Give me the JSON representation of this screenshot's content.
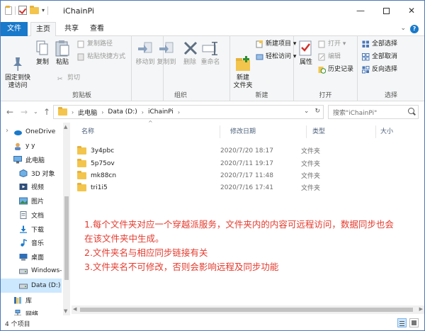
{
  "window": {
    "title": "iChainPi",
    "minimize_icon": "minimize-icon",
    "maximize_icon": "maximize-icon",
    "close_icon": "close-icon"
  },
  "tabs": {
    "file": "文件",
    "home": "主页",
    "share": "共享",
    "view": "查看"
  },
  "ribbon": {
    "clipboard": {
      "label": "剪贴板",
      "pin": "固定到快\n速访问",
      "copy": "复制",
      "paste": "粘贴",
      "cut": "剪切",
      "copy_path": "复制路径",
      "paste_shortcut": "粘贴快捷方式"
    },
    "organize": {
      "label": "组织",
      "move_to": "移动到",
      "copy_to": "复制到",
      "delete": "删除",
      "rename": "重命名"
    },
    "new": {
      "label": "新建",
      "new_folder": "新建\n文件夹",
      "new_item": "新建项目 ▾",
      "easy_access": "轻松访问 ▾"
    },
    "open": {
      "label": "打开",
      "properties": "属性",
      "open": "打开 ▾",
      "edit": "编辑",
      "history": "历史记录"
    },
    "select": {
      "label": "选择",
      "select_all": "全部选择",
      "select_none": "全部取消",
      "invert": "反向选择"
    }
  },
  "address": {
    "crumbs": [
      "此电脑",
      "Data (D:)",
      "iChainPi"
    ],
    "search_placeholder": "搜索\"iChainPi\""
  },
  "nav": [
    {
      "label": "OneDrive",
      "icon": "onedrive-icon"
    },
    {
      "label": "y y",
      "icon": "user-icon"
    },
    {
      "label": "此电脑",
      "icon": "computer-icon"
    },
    {
      "label": "3D 对象",
      "icon": "3d-objects-icon"
    },
    {
      "label": "视频",
      "icon": "video-icon"
    },
    {
      "label": "图片",
      "icon": "picture-icon"
    },
    {
      "label": "文档",
      "icon": "document-icon"
    },
    {
      "label": "下载",
      "icon": "download-icon"
    },
    {
      "label": "音乐",
      "icon": "music-icon"
    },
    {
      "label": "桌面",
      "icon": "desktop-icon"
    },
    {
      "label": "Windows-",
      "icon": "drive-icon"
    },
    {
      "label": "Data (D:)",
      "icon": "drive-icon"
    },
    {
      "label": "库",
      "icon": "library-icon"
    },
    {
      "label": "网络",
      "icon": "network-icon"
    }
  ],
  "columns": {
    "name": "名称",
    "date": "修改日期",
    "type": "类型",
    "size": "大小"
  },
  "files": [
    {
      "name": "3y4pbc",
      "date": "2020/7/20 18:17",
      "type": "文件夹"
    },
    {
      "name": "5p75ov",
      "date": "2020/7/11 19:17",
      "type": "文件夹"
    },
    {
      "name": "mk88cn",
      "date": "2020/7/17 11:48",
      "type": "文件夹"
    },
    {
      "name": "tri1i5",
      "date": "2020/7/16 17:41",
      "type": "文件夹"
    }
  ],
  "note": [
    "1.每个文件夹对应一个穿越派服务，文件夹内的内容可远程访问，数据同步也会",
    "在该文件夹中生成。",
    "2.文件夹名与相应同步链接有关",
    "3.文件夹名不可修改，否则会影响远程及同步功能"
  ],
  "status": {
    "count": "4 个项目"
  },
  "colors": {
    "accent": "#1979ca",
    "note": "#e33b2e",
    "folder": "#f3c54d",
    "selection": "#cce8ff"
  }
}
